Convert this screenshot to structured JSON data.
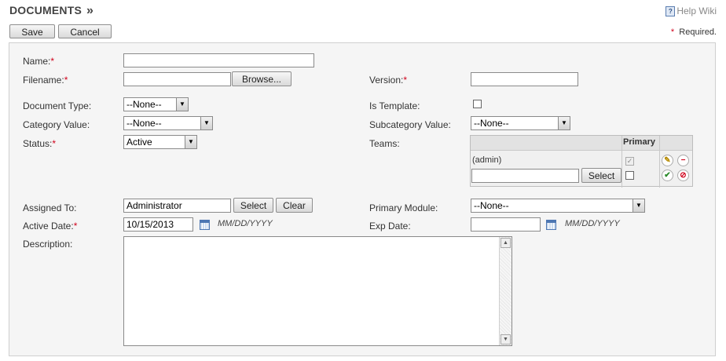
{
  "header": {
    "title": "DOCUMENTS",
    "chevron": "»",
    "help_label": "Help Wiki",
    "help_icon": "help-book-icon"
  },
  "toolbar": {
    "save_label": "Save",
    "cancel_label": "Cancel"
  },
  "required_note": {
    "star": "*",
    "text": "Required."
  },
  "form": {
    "name": {
      "label": "Name:",
      "star": "*",
      "value": ""
    },
    "filename": {
      "label": "Filename:",
      "star": "*",
      "value": "",
      "browse_label": "Browse..."
    },
    "version": {
      "label": "Version:",
      "star": "*",
      "value": ""
    },
    "document_type": {
      "label": "Document Type:",
      "value": "--None--"
    },
    "is_template": {
      "label": "Is Template:",
      "checked": false
    },
    "category_value": {
      "label": "Category Value:",
      "value": "--None--"
    },
    "subcategory_value": {
      "label": "Subcategory Value:",
      "value": "--None--"
    },
    "status": {
      "label": "Status:",
      "star": "*",
      "value": "Active"
    },
    "teams": {
      "label": "Teams:",
      "header_primary": "Primary",
      "rows": [
        {
          "name": "(admin)",
          "primary": true
        }
      ],
      "new_row": {
        "value": "",
        "select_label": "Select"
      }
    },
    "assigned_to": {
      "label": "Assigned To:",
      "value": "Administrator",
      "select_label": "Select",
      "clear_label": "Clear"
    },
    "primary_module": {
      "label": "Primary Module:",
      "value": "--None--"
    },
    "active_date": {
      "label": "Active Date:",
      "star": "*",
      "value": "10/15/2013",
      "hint": "MM/DD/YYYY"
    },
    "exp_date": {
      "label": "Exp Date:",
      "value": "",
      "hint": "MM/DD/YYYY"
    },
    "description": {
      "label": "Description:",
      "value": ""
    }
  },
  "colors": {
    "required_star": "#d0021b",
    "panel_bg": "#f5f5f5",
    "accent_blue": "#4d77b3"
  }
}
